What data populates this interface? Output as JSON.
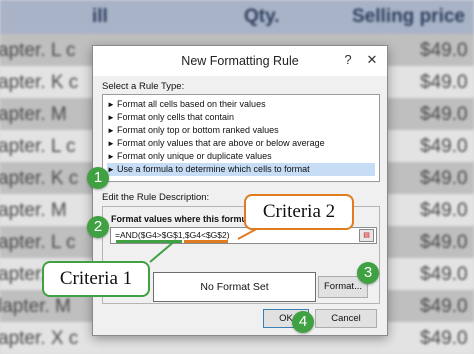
{
  "spreadsheet": {
    "headers": [
      "ill",
      "Qty.",
      "Selling price"
    ],
    "rows": [
      {
        "name": "apter. L c",
        "price": "$49.0"
      },
      {
        "name": "apter. K c",
        "price": "$49.0"
      },
      {
        "name": "apter. M",
        "price": "$49.0"
      },
      {
        "name": "apter. L c",
        "price": "$49.0"
      },
      {
        "name": "apter. K c",
        "price": "$49.0"
      },
      {
        "name": "apter. M",
        "price": "$49.0"
      },
      {
        "name": "apter. L c",
        "price": "$49.0"
      },
      {
        "name": "apter. K",
        "price": "$49.0"
      },
      {
        "name": "lapter. M",
        "price": "$49.0"
      },
      {
        "name": "apter. X c",
        "price": "$49.0"
      },
      {
        "name": "lapter. K",
        "price": "$49.0"
      }
    ]
  },
  "dialog": {
    "title": "New Formatting Rule",
    "help_glyph": "?",
    "close_glyph": "✕",
    "select_rule_label": "Select a Rule Type:",
    "rule_types": [
      "Format all cells based on their values",
      "Format only cells that contain",
      "Format only top or bottom ranked values",
      "Format only values that are above or below average",
      "Format only unique or duplicate values",
      "Use a formula to determine which cells to format"
    ],
    "selected_rule_index": 5,
    "edit_rule_label": "Edit the Rule Description:",
    "format_values_label": "Format values where this formula is true:",
    "formula_value": "=AND($G4>$G$1,$G4<$G$2)",
    "preview_text": "No Format Set",
    "format_button": "Format...",
    "ok_button": "OK",
    "cancel_button": "Cancel"
  },
  "annotations": {
    "markers": [
      "1",
      "2",
      "3",
      "4"
    ],
    "criteria_1": "Criteria 1",
    "criteria_2": "Criteria 2",
    "criteria_1_color": "#3fa142",
    "criteria_2_color": "#e07b20"
  }
}
